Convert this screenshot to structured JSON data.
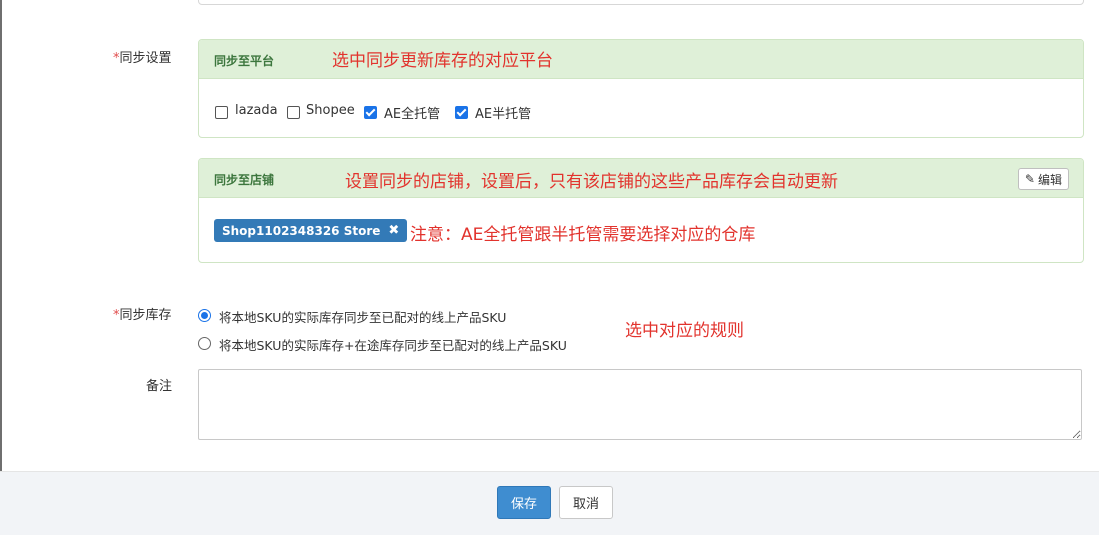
{
  "form": {
    "sync_settings": {
      "asterisk": "*",
      "label": "同步设置"
    },
    "sync_stock": {
      "asterisk": "*",
      "label": "同步库存"
    },
    "remark": {
      "label": "备注",
      "value": ""
    }
  },
  "platform_panel": {
    "title": "同步至平台",
    "annotation": "选中同步更新库存的对应平台",
    "options": [
      {
        "label": "lazada",
        "checked": false
      },
      {
        "label": "Shopee",
        "checked": false
      },
      {
        "label": "AE全托管",
        "checked": true
      },
      {
        "label": "AE半托管",
        "checked": true
      }
    ]
  },
  "store_panel": {
    "title": "同步至店铺",
    "annotation": "设置同步的店铺，设置后，只有该店铺的这些产品库存会自动更新",
    "edit_label": "编辑",
    "store_tag": "Shop1102348326 Store",
    "tag_remove": "✖",
    "note": "注意：AE全托管跟半托管需要选择对应的仓库"
  },
  "stock_rules": {
    "options": [
      {
        "label": "将本地SKU的实际库存同步至已配对的线上产品SKU",
        "selected": true
      },
      {
        "label": "将本地SKU的实际库存+在途库存同步至已配对的线上产品SKU",
        "selected": false
      }
    ],
    "annotation": "选中对应的规则"
  },
  "footer": {
    "save_label": "保存",
    "cancel_label": "取消"
  },
  "colors": {
    "annotation": "#e2332d",
    "panel_heading_bg": "#dff0d8",
    "panel_title": "#3c763d",
    "primary": "#3f8dd0",
    "tag": "#337ab7"
  },
  "icons": {
    "edit": "edit-icon",
    "remove": "close-icon"
  }
}
